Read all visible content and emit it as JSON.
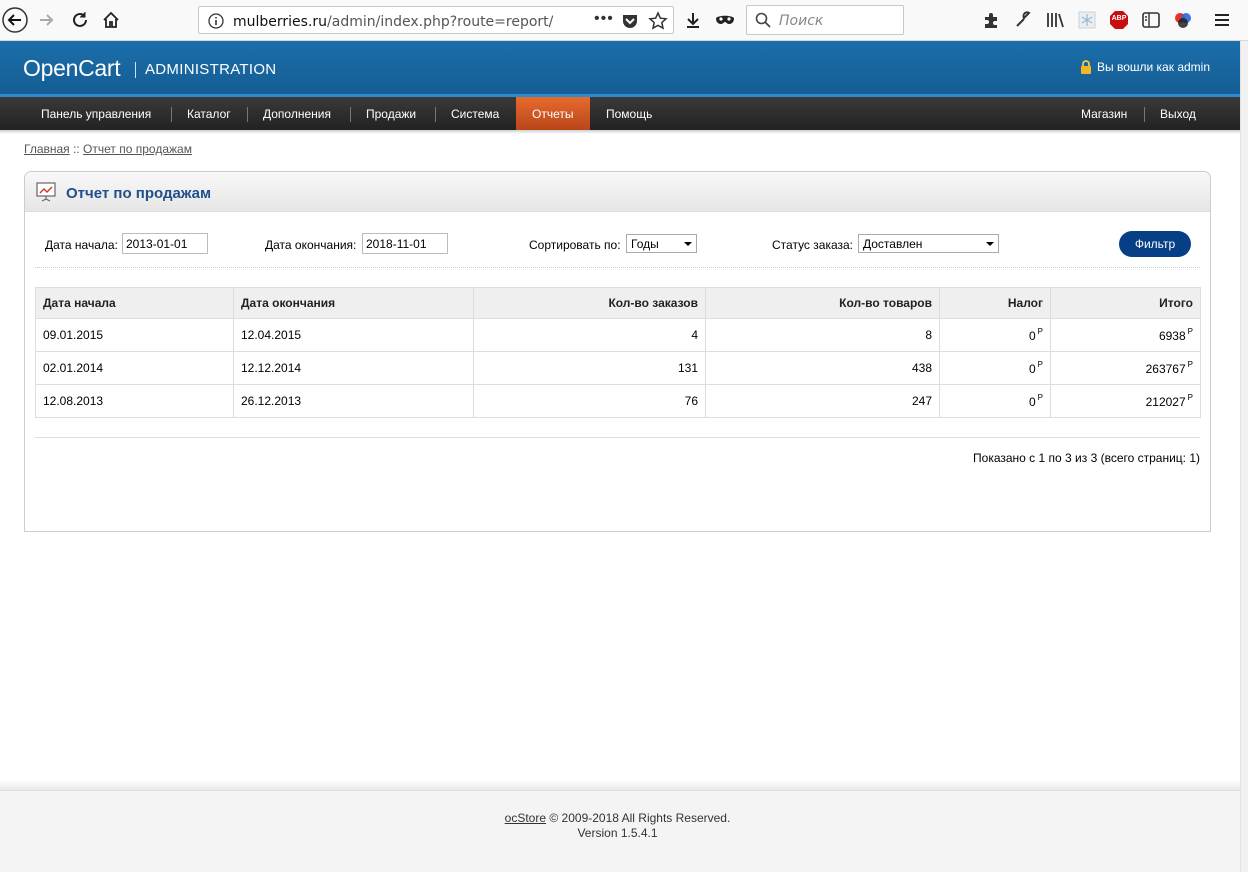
{
  "browser": {
    "url_host": "mulberries.ru",
    "url_path": "/admin/index.php?route=report/sale_orc",
    "search_placeholder": "Поиск",
    "adblock_badge": "ABP"
  },
  "header": {
    "logo": "OpenCart",
    "subtitle": "ADMINISTRATION",
    "user_status": "Вы вошли как admin"
  },
  "menu": {
    "items": [
      "Панель управления",
      "Каталог",
      "Дополнения",
      "Продажи",
      "Система",
      "Отчеты",
      "Помощь"
    ],
    "right": [
      "Магазин",
      "Выход"
    ]
  },
  "breadcrumb": {
    "home": "Главная",
    "separator": "::",
    "current": "Отчет по продажам"
  },
  "page": {
    "title": "Отчет по продажам"
  },
  "filter": {
    "date_start_label": "Дата начала:",
    "date_start_value": "2013-01-01",
    "date_end_label": "Дата окончания:",
    "date_end_value": "2018-11-01",
    "group_label": "Сортировать по:",
    "group_value": "Годы",
    "status_label": "Статус заказа:",
    "status_value": "Доставлен",
    "button": "Фильтр"
  },
  "table": {
    "headers": [
      "Дата начала",
      "Дата окончания",
      "Кол-во заказов",
      "Кол-во товаров",
      "Налог",
      "Итого"
    ],
    "currency": "Р",
    "rows": [
      {
        "start": "09.01.2015",
        "end": "12.04.2015",
        "orders": "4",
        "products": "8",
        "tax": "0",
        "total": "6938"
      },
      {
        "start": "02.01.2014",
        "end": "12.12.2014",
        "orders": "131",
        "products": "438",
        "tax": "0",
        "total": "263767"
      },
      {
        "start": "12.08.2013",
        "end": "26.12.2013",
        "orders": "76",
        "products": "247",
        "tax": "0",
        "total": "212027"
      }
    ]
  },
  "pagination": "Показано с 1 по 3 из 3 (всего страниц: 1)",
  "footer": {
    "brand": "ocStore",
    "copyright": "© 2009-2018 All Rights Reserved.",
    "version": "Version 1.5.4.1"
  }
}
